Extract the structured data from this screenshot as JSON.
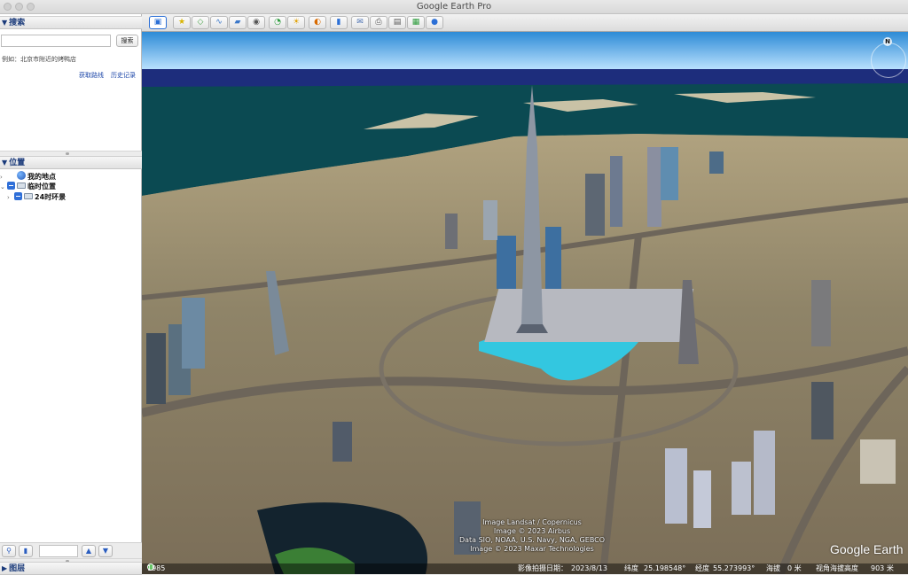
{
  "window": {
    "title": "Google Earth Pro"
  },
  "search": {
    "header": "搜索",
    "button": "搜索",
    "example": "例如：北京市附近的烤鸭店",
    "links": [
      "获取路线",
      "历史记录"
    ]
  },
  "places": {
    "header": "位置",
    "items": [
      {
        "label": "我的地点"
      },
      {
        "label": "临时位置"
      },
      {
        "label": "24时环景"
      }
    ]
  },
  "layers": {
    "header": "图层"
  },
  "toolbar": {
    "icons": [
      "sidebar-toggle-icon",
      "placemark-icon",
      "polygon-icon",
      "path-icon",
      "image-overlay-icon",
      "record-tour-icon",
      "historical-imagery-icon",
      "sunlight-icon",
      "planets-icon",
      "ruler-icon",
      "email-icon",
      "print-icon",
      "save-image-icon",
      "maps-icon",
      "earth-icon"
    ]
  },
  "map": {
    "compass_label": "N",
    "credits": [
      "Image Landsat / Copernicus",
      "Image © 2023 Airbus",
      "Data SIO, NOAA, U.S. Navy, NGA, GEBCO",
      "Image © 2023 Maxar Technologies"
    ],
    "brand": "Google Earth"
  },
  "status": {
    "year": "1985",
    "imagery_date_label": "影像拍摄日期：",
    "imagery_date": "2023/8/13",
    "lat_label": "纬度",
    "lat": "25.198548°",
    "lon_label": "经度",
    "lon": "55.273993°",
    "elev_label": "海拔",
    "elev": "0 米",
    "eye_label": "视角海拔高度",
    "eye": "903 米"
  }
}
